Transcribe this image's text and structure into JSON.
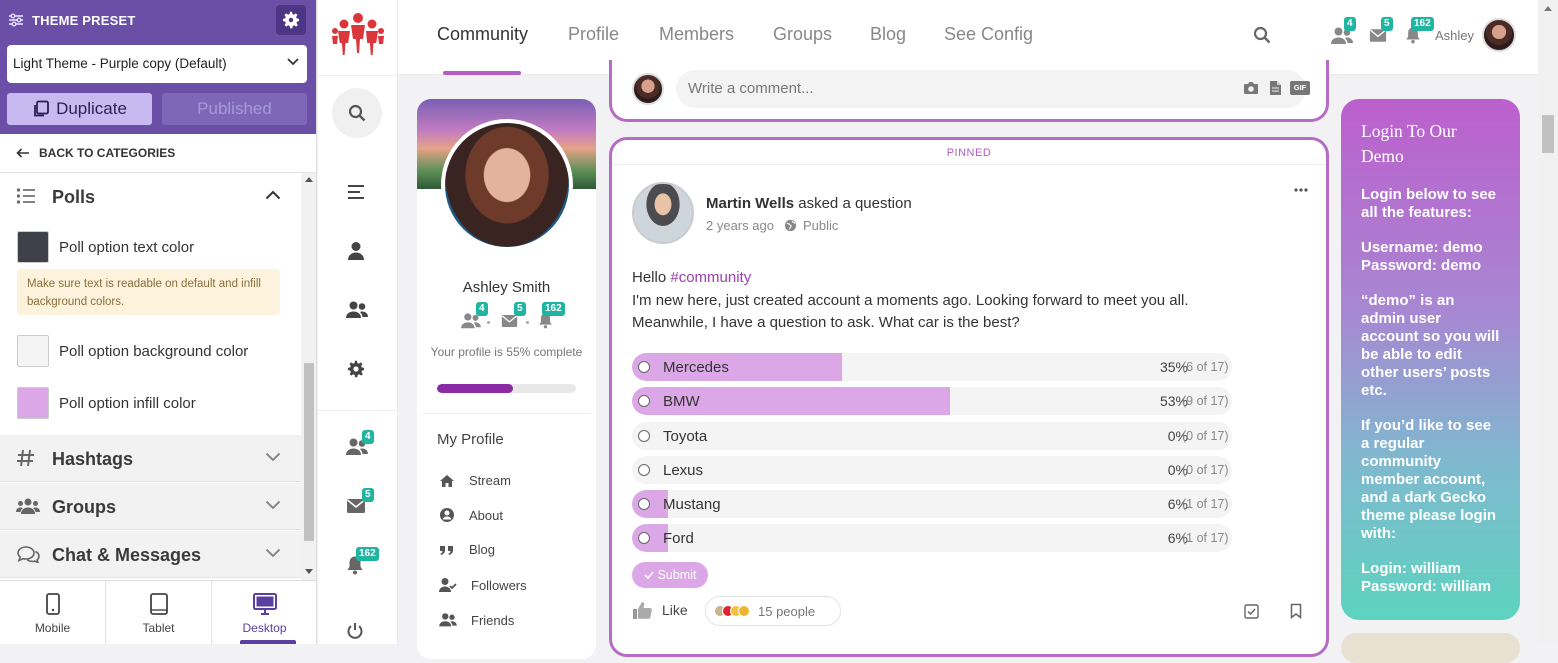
{
  "panel": {
    "title": "THEME PRESET",
    "preset_select": "Light Theme - Purple copy (Default)",
    "duplicate_label": "Duplicate",
    "published_label": "Published",
    "back_label": "BACK TO CATEGORIES",
    "polls_label": "Polls",
    "options": [
      {
        "label": "Poll option text color",
        "color": "#3f4049"
      },
      {
        "label": "Poll option background color",
        "color": "#f4f4f4"
      },
      {
        "label": "Poll option infill color",
        "color": "#dca7e6"
      }
    ],
    "note": "Make sure text is readable on default and infill background colors.",
    "sections": [
      {
        "label": "Hashtags",
        "icon": "hash-icon"
      },
      {
        "label": "Groups",
        "icon": "groups-icon"
      },
      {
        "label": "Chat & Messages",
        "icon": "chat-icon"
      }
    ],
    "devices": [
      {
        "label": "Mobile"
      },
      {
        "label": "Tablet"
      },
      {
        "label": "Desktop",
        "active": true
      }
    ],
    "accent_color": "#6b4fa7"
  },
  "iconbar": {
    "badges": {
      "friends": "4",
      "messages": "5",
      "notifications": "162"
    }
  },
  "topnav": {
    "links": [
      "Community",
      "Profile",
      "Members",
      "Groups",
      "Blog",
      "See Config"
    ],
    "active": "Community",
    "username": "Ashley",
    "badges": {
      "friends": "4",
      "messages": "5",
      "notifications": "162"
    }
  },
  "profile": {
    "name": "Ashley Smith",
    "badges": {
      "friends": "4",
      "messages": "5",
      "notifications": "162"
    },
    "completion_text": "Your profile is 55% complete",
    "completion": 0.55,
    "menu_title": "My Profile",
    "menu": [
      {
        "label": "Stream",
        "icon": "home-icon"
      },
      {
        "label": "About",
        "icon": "user-circle-icon"
      },
      {
        "label": "Blog",
        "icon": "quote-icon"
      },
      {
        "label": "Followers",
        "icon": "user-check-icon"
      },
      {
        "label": "Friends",
        "icon": "friends-icon"
      }
    ]
  },
  "comment": {
    "placeholder": "Write a comment...",
    "gif_label": "GIF"
  },
  "post": {
    "pinned_label": "PINNED",
    "author": "Martin Wells",
    "action": "asked a question",
    "time": "2 years ago",
    "privacy": "Public",
    "text_hello": "Hello ",
    "hashtag": "#community",
    "text_line2": "I'm new here, just created account a moments ago. Looking forward to meet you all.",
    "text_line3": "Meanwhile, I have a question to ask. What car is the best?",
    "poll": [
      {
        "label": "Mercedes",
        "pct": "35%",
        "count": "(6 of 17)",
        "fraction": 0.35
      },
      {
        "label": "BMW",
        "pct": "53%",
        "count": "(9 of 17)",
        "fraction": 0.53
      },
      {
        "label": "Toyota",
        "pct": "0%",
        "count": "(0 of 17)",
        "fraction": 0
      },
      {
        "label": "Lexus",
        "pct": "0%",
        "count": "(0 of 17)",
        "fraction": 0
      },
      {
        "label": "Mustang",
        "pct": "6%",
        "count": "(1 of 17)",
        "fraction": 0.06
      },
      {
        "label": "Ford",
        "pct": "6%",
        "count": "(1 of 17)",
        "fraction": 0.06
      }
    ],
    "submit_label": "Submit",
    "like_label": "Like",
    "reactions_label": "15 people"
  },
  "demo": {
    "title": "Login To Our Demo",
    "intro": "Login below to see all the features:",
    "username_label": "Username:",
    "username": "demo",
    "password_label": "Password:",
    "password": "demo",
    "admin_note": "“demo” is an admin user account so you will be able to edit other users’ posts etc.",
    "regular_note": "If you’d like to see a regular community member account, and a dark Gecko theme please login with:",
    "login_label": "Login:",
    "login": "william",
    "password2_label": "Password:",
    "password2": "william"
  }
}
